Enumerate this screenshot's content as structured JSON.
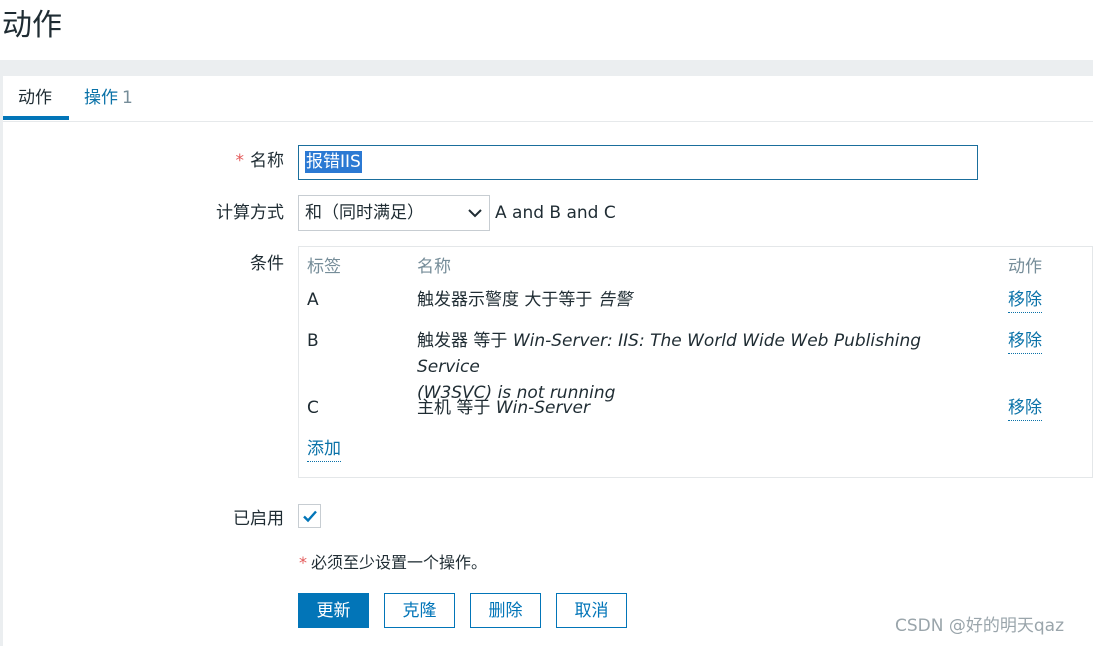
{
  "page": {
    "title": "动作"
  },
  "tabs": [
    {
      "label": "动作"
    },
    {
      "label": "操作",
      "count": "1"
    }
  ],
  "form": {
    "name_label": "名称",
    "name_required_mark": "*",
    "name_value": "报错IIS",
    "calc_label": "计算方式",
    "calc_selected": "和（同时满足）",
    "calc_formula": "A and B and C",
    "conditions_label": "条件",
    "enabled_label": "已启用",
    "enabled_checked": true
  },
  "conditions": {
    "headers": {
      "tag": "标签",
      "name": "名称",
      "action": "动作"
    },
    "rows": [
      {
        "tag": "A",
        "prefix": "触发器示警度 大于等于 ",
        "value_line1": "告警",
        "value_line2": "",
        "action": "移除"
      },
      {
        "tag": "B",
        "prefix": "触发器 等于 ",
        "value_line1": "Win-Server: IIS: The World Wide Web Publishing Service",
        "value_line2": "(W3SVC) is not running",
        "action": "移除"
      },
      {
        "tag": "C",
        "prefix": "主机 等于 ",
        "value_line1": "Win-Server",
        "value_line2": "",
        "action": "移除"
      }
    ],
    "add_label": "添加"
  },
  "hint": {
    "star": "*",
    "text": "必须至少设置一个操作。"
  },
  "buttons": {
    "update": "更新",
    "clone": "克隆",
    "delete": "删除",
    "cancel": "取消"
  },
  "watermark": "CSDN @好的明天qaz",
  "colors": {
    "accent": "#0275b8",
    "link": "#0a72a8",
    "required": "#e45959",
    "background": "#ebeef0"
  }
}
